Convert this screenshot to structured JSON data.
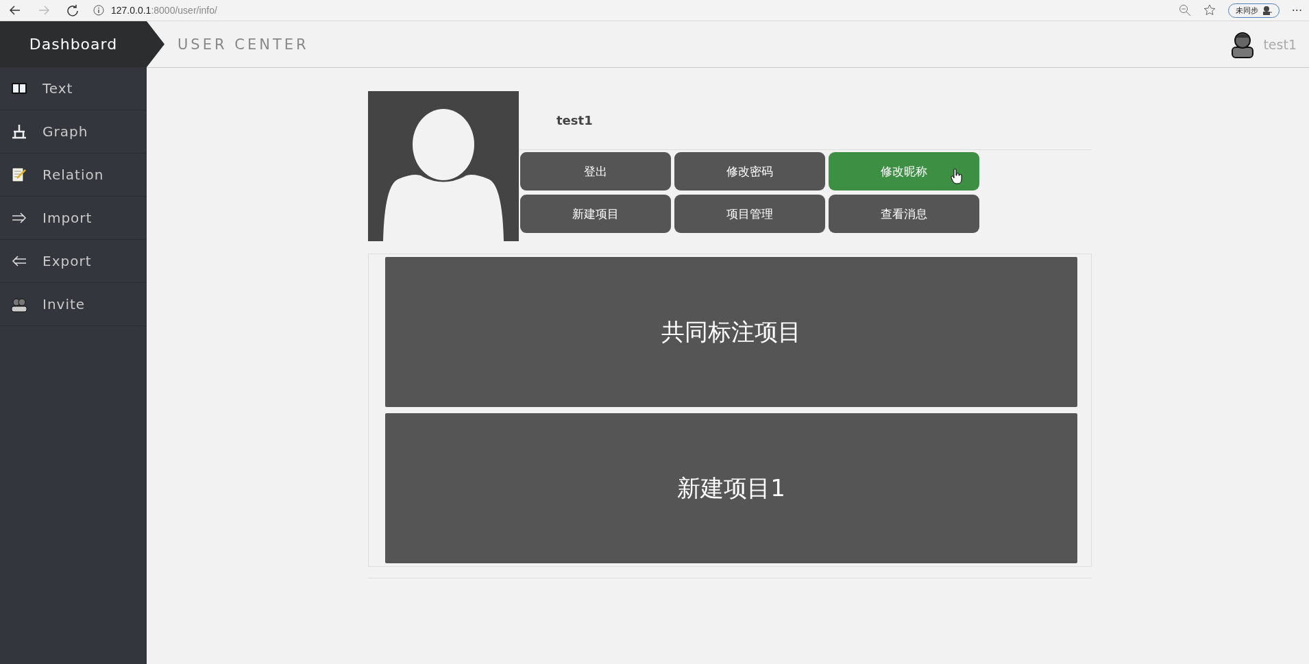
{
  "browser": {
    "url_host": "127.0.0.1",
    "url_path": ":8000/user/info/",
    "forward_disabled": true,
    "sync_label": "未同步",
    "menu": "···"
  },
  "sidebar": {
    "brand": "Dashboard",
    "items": [
      {
        "label": "Text"
      },
      {
        "label": "Graph"
      },
      {
        "label": "Relation"
      },
      {
        "label": "Import"
      },
      {
        "label": "Export"
      },
      {
        "label": "Invite"
      }
    ]
  },
  "header": {
    "title": "USER CENTER",
    "user": "test1"
  },
  "profile": {
    "name": "test1",
    "buttons": [
      {
        "label": "登出",
        "hovered": false
      },
      {
        "label": "修改密码",
        "hovered": false
      },
      {
        "label": "修改昵称",
        "hovered": true
      },
      {
        "label": "新建项目",
        "hovered": false
      },
      {
        "label": "项目管理",
        "hovered": false
      },
      {
        "label": "查看消息",
        "hovered": false
      }
    ]
  },
  "projects": [
    {
      "title": "共同标注项目"
    },
    {
      "title": "新建项目1"
    }
  ]
}
